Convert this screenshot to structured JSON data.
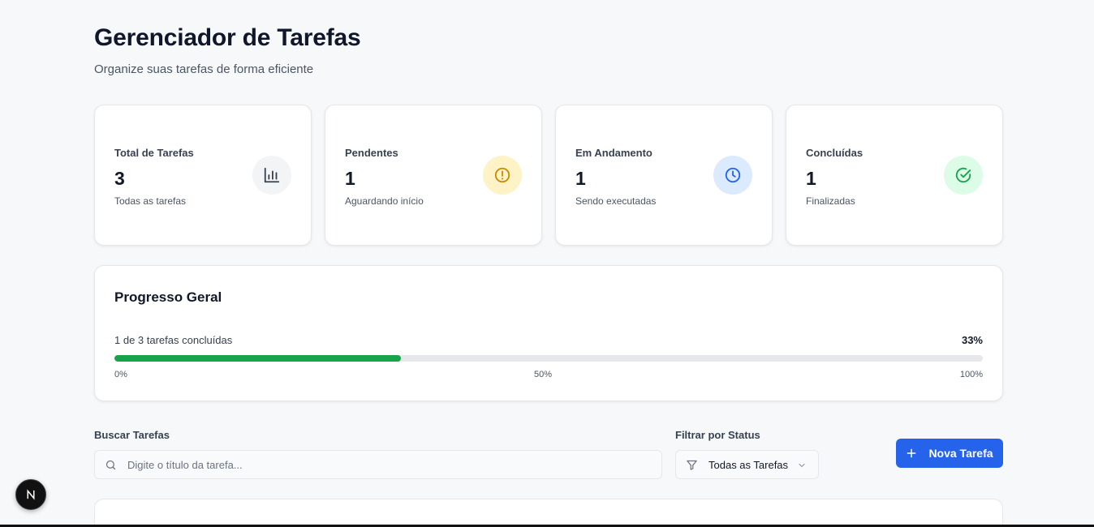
{
  "header": {
    "title": "Gerenciador de Tarefas",
    "subtitle": "Organize suas tarefas de forma eficiente"
  },
  "stats": [
    {
      "label": "Total de Tarefas",
      "value": "3",
      "description": "Todas as tarefas",
      "icon": "bar-chart-icon",
      "icon_bg": "#f3f4f6",
      "icon_color": "#374151"
    },
    {
      "label": "Pendentes",
      "value": "1",
      "description": "Aguardando início",
      "icon": "alert-circle-icon",
      "icon_bg": "#fef3c7",
      "icon_color": "#ca8a04"
    },
    {
      "label": "Em Andamento",
      "value": "1",
      "description": "Sendo executadas",
      "icon": "clock-icon",
      "icon_bg": "#dbeafe",
      "icon_color": "#2563eb"
    },
    {
      "label": "Concluídas",
      "value": "1",
      "description": "Finalizadas",
      "icon": "check-circle-icon",
      "icon_bg": "#dcfce7",
      "icon_color": "#16a34a"
    }
  ],
  "progress": {
    "title": "Progresso Geral",
    "count_text": "1 de 3 tarefas concluídas",
    "percent_text": "33%",
    "value": 0.33,
    "ticks": [
      "0%",
      "50%",
      "100%"
    ],
    "fill_color": "#16a34a"
  },
  "filters": {
    "search_label": "Buscar Tarefas",
    "search_placeholder": "Digite o título da tarefa...",
    "status_label": "Filtrar por Status",
    "status_value": "Todas as Tarefas",
    "new_button_label": "Nova Tarefa"
  },
  "dev_badge": {
    "letter": "N"
  },
  "colors": {
    "accent": "#2563eb",
    "background": "#f7f8f9"
  }
}
